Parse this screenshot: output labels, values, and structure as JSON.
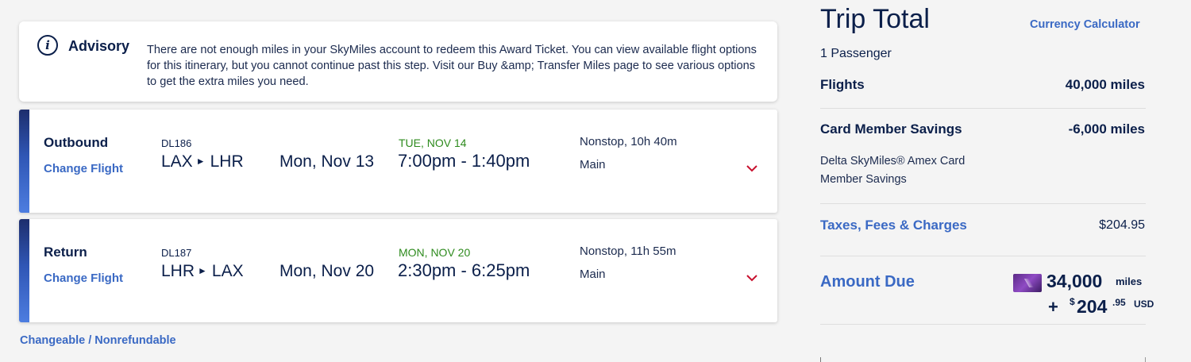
{
  "advisory": {
    "icon": "info-icon",
    "icon_glyph": "i",
    "title": "Advisory",
    "message": "There are not enough miles in your SkyMiles account to redeem this Award Ticket. You can view available flight options for this itinerary, but you cannot continue past this step. Visit our Buy &amp; Transfer Miles page to see various options to get the extra miles you need."
  },
  "flights": [
    {
      "leg": "Outbound",
      "change_label": "Change Flight",
      "flight_number": "DL186",
      "origin": "LAX",
      "destination": "LHR",
      "date": "Mon, Nov 13",
      "arrival_day": "TUE, NOV 14",
      "times": "7:00pm - 1:40pm",
      "stops_duration": "Nonstop, 10h 40m",
      "cabin": "Main"
    },
    {
      "leg": "Return",
      "change_label": "Change Flight",
      "flight_number": "DL187",
      "origin": "LHR",
      "destination": "LAX",
      "date": "Mon, Nov 20",
      "arrival_day": "MON, NOV 20",
      "times": "2:30pm - 6:25pm",
      "stops_duration": "Nonstop, 11h 55m",
      "cabin": "Main"
    }
  ],
  "fare_note": "Changeable / Nonrefundable",
  "trip_total": {
    "title": "Trip Total",
    "currency_link": "Currency Calculator",
    "passengers": "1 Passenger",
    "flights_label": "Flights",
    "flights_value": "40,000 miles",
    "savings_label": "Card Member Savings",
    "savings_value": "-6,000 miles",
    "savings_sub": "Delta SkyMiles® Amex Card Member Savings",
    "taxes_label": "Taxes, Fees & Charges",
    "taxes_value": "$204.95",
    "amount_due_label": "Amount Due",
    "due_miles": "34,000",
    "due_miles_unit": "miles",
    "due_plus": "+",
    "due_dollar_sign": "$",
    "due_dollars": "204",
    "due_cents": ".95",
    "due_currency": "USD"
  },
  "colors": {
    "navy": "#0b1f4a",
    "link_blue": "#3a69c4",
    "arrival_green": "#2e8b1e",
    "chevron_red": "#c8102e"
  }
}
